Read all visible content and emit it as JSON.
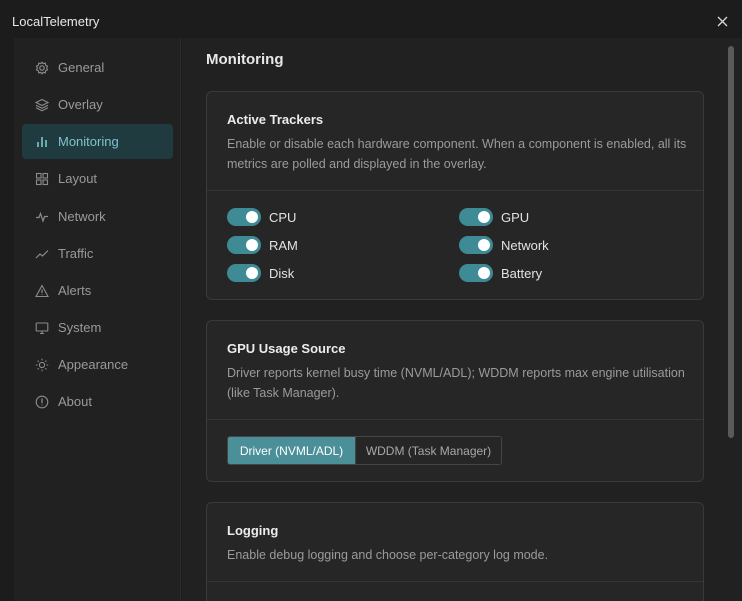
{
  "app": {
    "title": "LocalTelemetry"
  },
  "sidebar": {
    "items": [
      {
        "label": "General",
        "icon": "gear-icon",
        "active": false
      },
      {
        "label": "Overlay",
        "icon": "layers-icon",
        "active": false
      },
      {
        "label": "Monitoring",
        "icon": "bar-chart-icon",
        "active": true
      },
      {
        "label": "Layout",
        "icon": "grid-icon",
        "active": false
      },
      {
        "label": "Network",
        "icon": "pulse-icon",
        "active": false
      },
      {
        "label": "Traffic",
        "icon": "trend-icon",
        "active": false
      },
      {
        "label": "Alerts",
        "icon": "warning-icon",
        "active": false
      },
      {
        "label": "System",
        "icon": "monitor-icon",
        "active": false
      },
      {
        "label": "Appearance",
        "icon": "sun-icon",
        "active": false
      },
      {
        "label": "About",
        "icon": "info-icon",
        "active": false
      }
    ]
  },
  "main": {
    "title": "Monitoring",
    "active_trackers": {
      "title": "Active Trackers",
      "description": "Enable or disable each hardware component. When a component is enabled, all its metrics are polled and displayed in the overlay.",
      "trackers": [
        {
          "label": "CPU",
          "enabled": true
        },
        {
          "label": "GPU",
          "enabled": true
        },
        {
          "label": "RAM",
          "enabled": true
        },
        {
          "label": "Network",
          "enabled": true
        },
        {
          "label": "Disk",
          "enabled": true
        },
        {
          "label": "Battery",
          "enabled": true
        }
      ]
    },
    "gpu_usage_source": {
      "title": "GPU Usage Source",
      "description": "Driver reports kernel busy time (NVML/ADL); WDDM reports max engine utilisation (like Task Manager).",
      "options": [
        "Driver (NVML/ADL)",
        "WDDM (Task Manager)"
      ],
      "selected": "Driver (NVML/ADL)"
    },
    "logging": {
      "title": "Logging",
      "description": "Enable debug logging and choose per-category log mode."
    }
  },
  "colors": {
    "accent": "#4b8f99",
    "toggle_on": "#3e8b96",
    "active_nav_bg": "#1f3b40",
    "active_nav_text": "#7fc3cc"
  }
}
